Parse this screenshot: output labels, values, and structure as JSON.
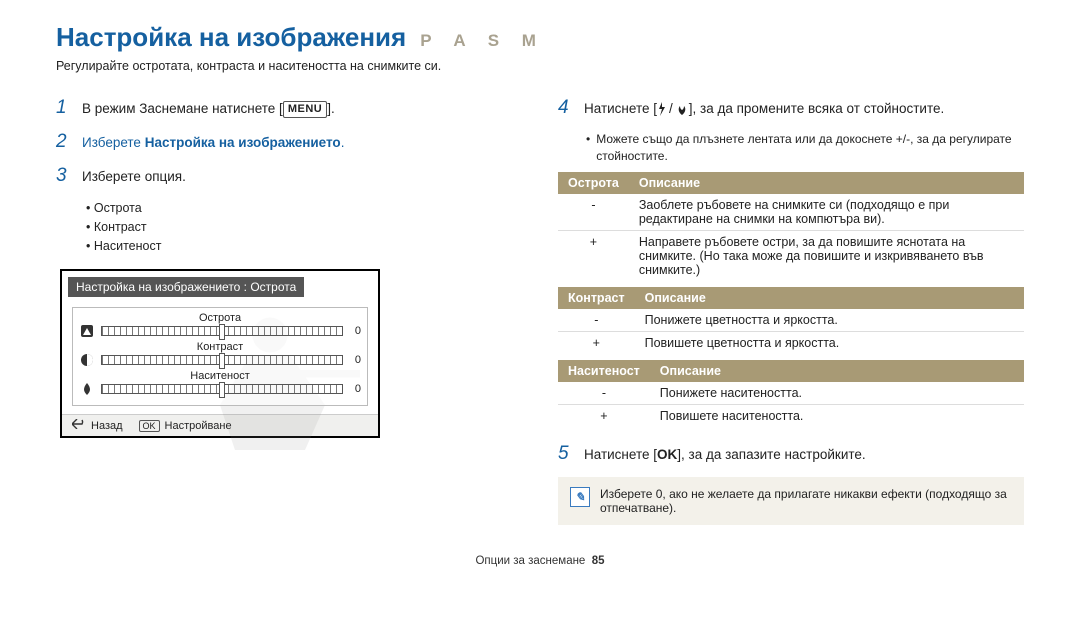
{
  "header": {
    "title": "Настройка на изображения",
    "modes": "P A S M",
    "subtitle": "Регулирайте остротата, контраста и наситеността на снимките си."
  },
  "left": {
    "step1_num": "1",
    "step1_a": "В режим Заснемане натиснете [",
    "step1_menu": "MENU",
    "step1_b": "].",
    "step2_num": "2",
    "step2_a": "Изберете ",
    "step2_bold": "Настройка на изображението",
    "step2_b": ".",
    "step3_num": "3",
    "step3": "Изберете опция.",
    "bullets": [
      "Острота",
      "Контраст",
      "Наситеност"
    ],
    "screen": {
      "title": "Настройка на изображението : Острота",
      "rows": [
        {
          "label": "Острота",
          "val": "0"
        },
        {
          "label": "Контраст",
          "val": "0"
        },
        {
          "label": "Наситеност",
          "val": "0"
        }
      ],
      "back": "Назад",
      "set_chip": "OK",
      "set": "Настройване"
    }
  },
  "right": {
    "step4_num": "4",
    "step4_a": "Натиснете [",
    "step4_b": "], за да промените всяка от стойностите.",
    "step4_sub": "Можете също да плъзнете лентата или да докоснете +/-, за да регулирате стойностите.",
    "tables": [
      {
        "h1": "Острота",
        "h2": "Описание",
        "rows": [
          {
            "sym": "-",
            "desc": "Заоблете ръбовете на снимките си (подходящо е при редактиране на снимки на компютъра ви)."
          },
          {
            "sym": "+",
            "desc": "Направете ръбовете остри, за да повишите яснотата на снимките. (Но така може да повишите и изкривяването във снимките.)"
          }
        ]
      },
      {
        "h1": "Контраст",
        "h2": "Описание",
        "rows": [
          {
            "sym": "-",
            "desc": "Понижете цветността и яркостта."
          },
          {
            "sym": "+",
            "desc": "Повишете цветността и яркостта."
          }
        ]
      },
      {
        "h1": "Наситеност",
        "h2": "Описание",
        "rows": [
          {
            "sym": "-",
            "desc": "Понижете наситеността."
          },
          {
            "sym": "+",
            "desc": "Повишете наситеността."
          }
        ]
      }
    ],
    "step5_num": "5",
    "step5_a": "Натиснете [",
    "step5_ok": "OK",
    "step5_b": "], за да запазите настройките.",
    "tip": "Изберете 0, ако не желаете да прилагате никакви ефекти (подходящо за отпечатване)."
  },
  "footer": {
    "section": "Опции за заснемане",
    "page": "85"
  }
}
